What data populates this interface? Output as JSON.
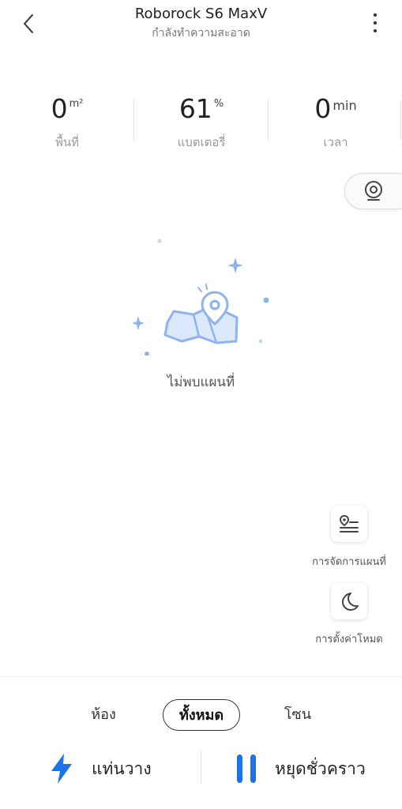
{
  "header": {
    "title": "Roborock S6 MaxV",
    "status": "กำลังทำความสะอาด"
  },
  "stats": [
    {
      "value": "0",
      "unit": "m²",
      "label": "พื้นที่"
    },
    {
      "value": "61",
      "unit": "%",
      "label": "แบตเตอรี่"
    },
    {
      "value": "0",
      "unit": "min",
      "label": "เวลา"
    }
  ],
  "map": {
    "empty_message": "ไม่พบแผนที่"
  },
  "side_buttons": {
    "map_manage": "การจัดการแผนที่",
    "mode_settings": "การตั้งค่าโหมด"
  },
  "tabs": [
    {
      "label": "ห้อง",
      "active": false
    },
    {
      "label": "ทั้งหมด",
      "active": true
    },
    {
      "label": "โซน",
      "active": false
    }
  ],
  "actions": {
    "dock": "แท่นวาง",
    "pause": "หยุดชั่วคราว"
  },
  "colors": {
    "accent": "#1a73e8",
    "illustration": "#8fb3ec"
  }
}
